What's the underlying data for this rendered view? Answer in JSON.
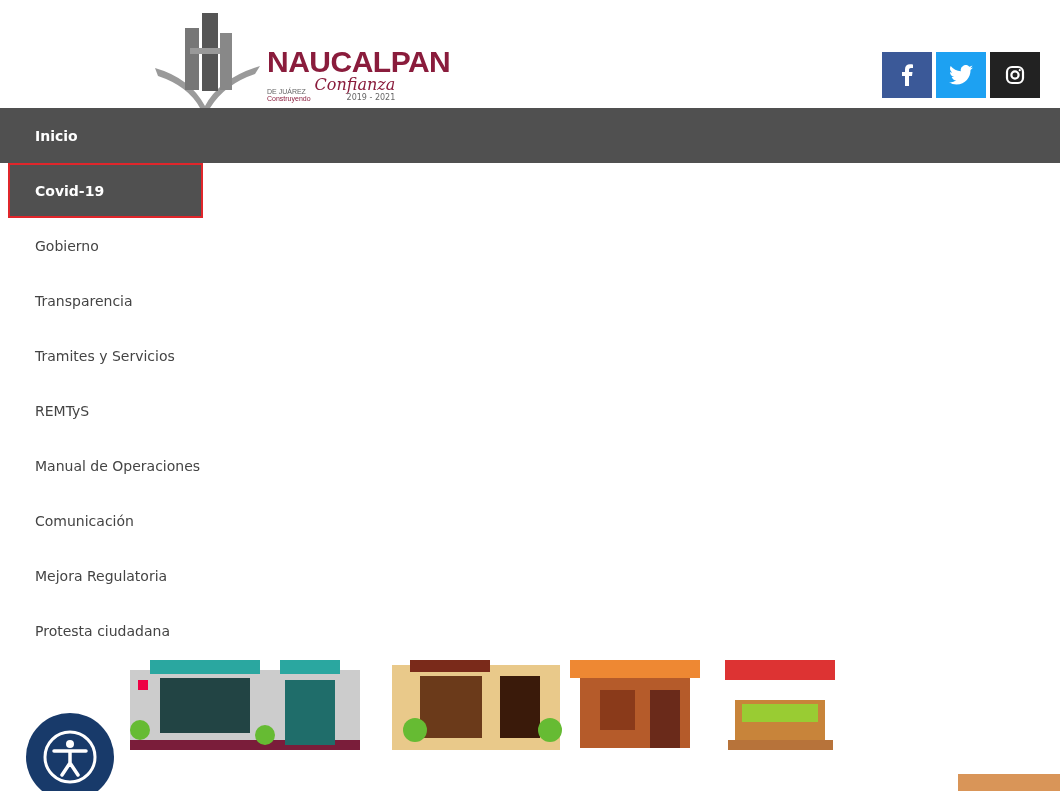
{
  "header": {
    "logo": {
      "name": "NAUCALPAN",
      "subtitle": "DE JUÁREZ",
      "tagline": "Construyendo",
      "script": "Confianza",
      "years": "2019 - 2021"
    },
    "social": [
      {
        "kind": "facebook"
      },
      {
        "kind": "twitter"
      },
      {
        "kind": "instagram"
      }
    ]
  },
  "nav": {
    "items": [
      {
        "label": "Inicio",
        "kind": "dark",
        "highlighted": false
      },
      {
        "label": "Covid-19",
        "kind": "dark",
        "highlighted": true
      },
      {
        "label": "Gobierno",
        "kind": "plain",
        "highlighted": false
      },
      {
        "label": "Transparencia",
        "kind": "plain",
        "highlighted": false
      },
      {
        "label": "Tramites y Servicios",
        "kind": "plain",
        "highlighted": false
      },
      {
        "label": "REMTyS",
        "kind": "plain",
        "highlighted": false
      },
      {
        "label": "Manual de Operaciones",
        "kind": "plain",
        "highlighted": false
      },
      {
        "label": "Comunicación",
        "kind": "plain",
        "highlighted": false
      },
      {
        "label": "Mejora Regulatoria",
        "kind": "plain",
        "highlighted": false
      },
      {
        "label": "Protesta ciudadana",
        "kind": "plain",
        "highlighted": false
      }
    ]
  }
}
